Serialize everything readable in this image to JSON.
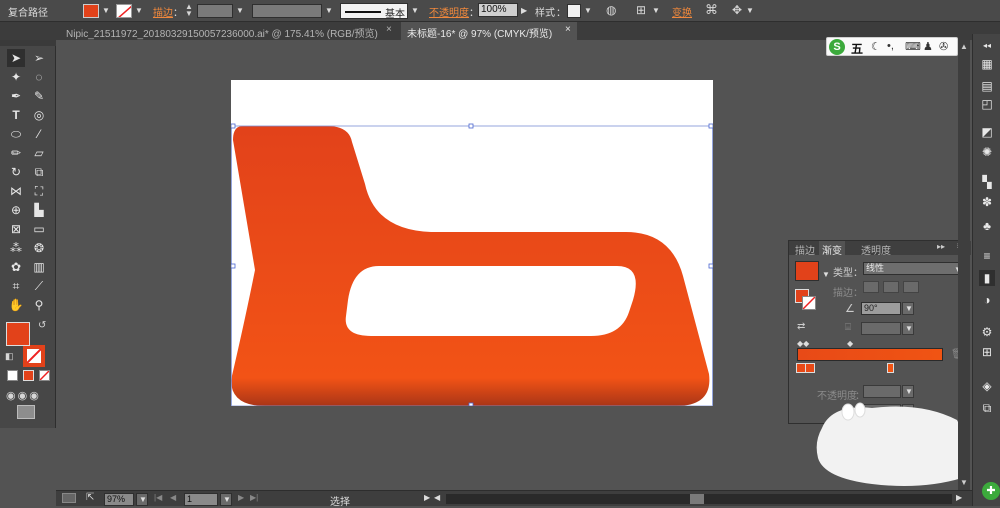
{
  "control_bar": {
    "object_type": "复合路径",
    "stroke_label": "描边",
    "stroke_colon": "：",
    "stroke_style": "基本",
    "opacity_label": "不透明度",
    "opacity_colon": "：",
    "opacity_value": "100%",
    "style_label": "样式",
    "style_colon": "：",
    "transform_label": "变换"
  },
  "tabs": [
    {
      "label": "Nipic_21511972_20180329150057236000.ai* @ 175.41% (RGB/预览)",
      "close": "×"
    },
    {
      "label": "未标题-16* @ 97% (CMYK/预览)",
      "close": "×"
    }
  ],
  "gradient_panel": {
    "tabs": [
      "描边",
      "渐变",
      "透明度"
    ],
    "type_label": "类型",
    "type_colon": "：",
    "type_value": "线性",
    "stroke_label": "描边",
    "stroke_colon": "：",
    "angle_value": "90°",
    "opacity_label": "不透明度",
    "opacity_colon": "：",
    "menu_glyph": "≡",
    "collapse_glyph": "▸▸"
  },
  "status_bar": {
    "zoom_value": "97%",
    "artboard_number": "1",
    "tool_status": "选择"
  },
  "ime_bar": {
    "mode_label": "五"
  },
  "colors": {
    "fill": "#e2421a",
    "gradient_start": "#e84a17",
    "gradient_end": "#f05413",
    "app_bg": "#535353",
    "accent_label": "#f0883c"
  }
}
